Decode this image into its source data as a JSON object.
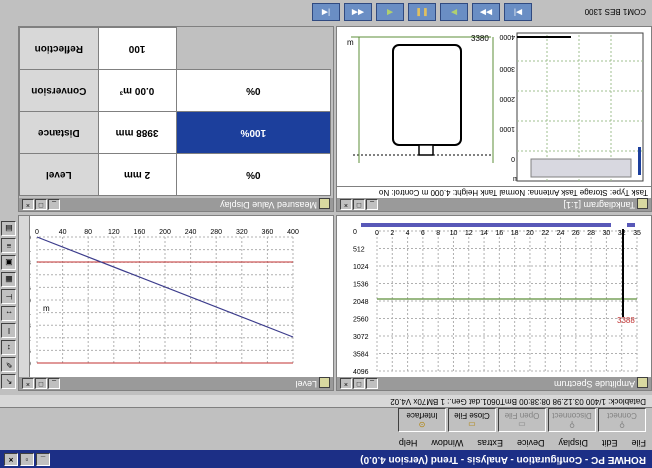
{
  "titlebar": {
    "title": "ROHWE PC - Configuration - Analysis - Trend    (Version 4.0.0)"
  },
  "menubar": {
    "items": [
      "File",
      "Edit",
      "Display",
      "Device",
      "Extras",
      "Window",
      "Help"
    ]
  },
  "toolbar": {
    "buttons": [
      {
        "label": "Connect",
        "enabled": false
      },
      {
        "label": "Disconnect",
        "enabled": false
      },
      {
        "label": "Open File",
        "enabled": false
      },
      {
        "label": "Close File",
        "enabled": true
      },
      {
        "label": "Interface",
        "enabled": true
      }
    ]
  },
  "statusbar": {
    "text": "Datablock: 1/400   03.12.98 08:38:00   BmT0601.dat   Gen.: 1   BM70x   V4.02"
  },
  "level_pane": {
    "title": "Level",
    "x_ticks": [
      "0",
      "40",
      "80",
      "120",
      "160",
      "200",
      "240",
      "280",
      "320",
      "360",
      "400"
    ],
    "y_ticks": [
      "0.0",
      "0.4",
      "0.8",
      "1.2",
      "1.6",
      "2.0",
      "2.4",
      "2.8",
      "3.2",
      "3.6",
      "4.0"
    ],
    "y_unit": "m"
  },
  "spectrum_pane": {
    "title": "Amplitude Spectrum",
    "x_ticks": [
      "0",
      "2",
      "4",
      "6",
      "8",
      "10",
      "12",
      "14",
      "16",
      "18",
      "20",
      "22",
      "24",
      "26",
      "28",
      "30",
      "32",
      "35"
    ],
    "y_ticks": [
      "0",
      "512",
      "1024",
      "1536",
      "2048",
      "2560",
      "3072",
      "3584",
      "4096"
    ],
    "marker_value": "3388"
  },
  "measured_pane": {
    "title": "Measured Value Display",
    "rows": [
      {
        "label": "Level",
        "value": "2 mm",
        "percent": "0%"
      },
      {
        "label": "Distance",
        "value": "3988 mm",
        "percent": "100%"
      },
      {
        "label": "Conversion",
        "value": "0.00 m³",
        "percent": "0%"
      },
      {
        "label": "Reflection",
        "value": "100",
        "percent": ""
      }
    ]
  },
  "tank_pane": {
    "title": "Tankdiagram [1:1]",
    "info": "Task Type: Storage Task  Antenna: Normal  Tank Height: 4.000 m  Control: No",
    "top_value": "3380",
    "unit_m": "m",
    "unit_mm": "mm",
    "ticks": [
      "4000",
      "3000",
      "2000",
      "1000",
      "0"
    ]
  },
  "window_tab": {
    "label": "COM1 BES 1300"
  },
  "colors": {
    "title_blue": "#1c2f86",
    "selection_blue": "#1c3f9c",
    "trend_line": "#3c3c8c",
    "grid_green": "#5e8f3a",
    "red_line": "#c03030",
    "spectrum_bar": "#5858b8"
  }
}
